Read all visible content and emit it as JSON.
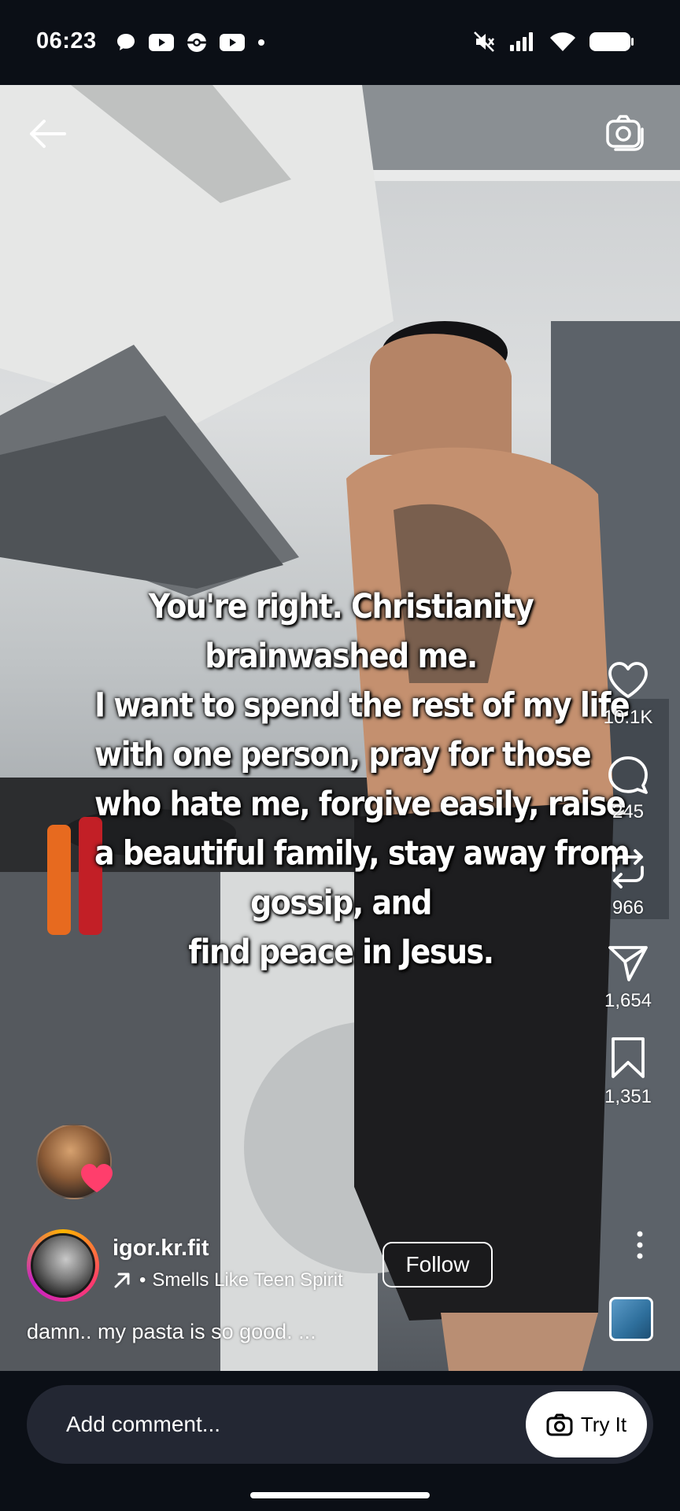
{
  "status_bar": {
    "time": "06:23",
    "left_icons": [
      "chat-bubble-icon",
      "youtube-icon",
      "pokeball-icon",
      "youtube-icon",
      "dot-icon"
    ],
    "right_icons": [
      "mute-icon",
      "signal-icon",
      "wifi-icon",
      "battery-icon"
    ]
  },
  "overlay": {
    "lines": [
      "You're right. Christianity",
      "brainwashed me.",
      "I want to spend the rest of my life",
      "with one person, pray for those",
      "who hate me, forgive easily, raise",
      "a beautiful family, stay away from",
      "gossip, and",
      "find peace in Jesus."
    ]
  },
  "rail": {
    "likes": "10.1K",
    "comments": "245",
    "reposts": "966",
    "shares": "1,654",
    "saves": "1,351"
  },
  "creator": {
    "username": "igor.kr.fit",
    "audio": "Smells Like Teen Spirit",
    "follow_label": "Follow",
    "caption": "damn.. my pasta is so good. ..."
  },
  "comment_bar": {
    "placeholder": "Add comment...",
    "try_it_label": "Try It"
  },
  "colors": {
    "background": "#0b0f16",
    "input_bg": "#232733",
    "heart": "#ff3e6c"
  }
}
